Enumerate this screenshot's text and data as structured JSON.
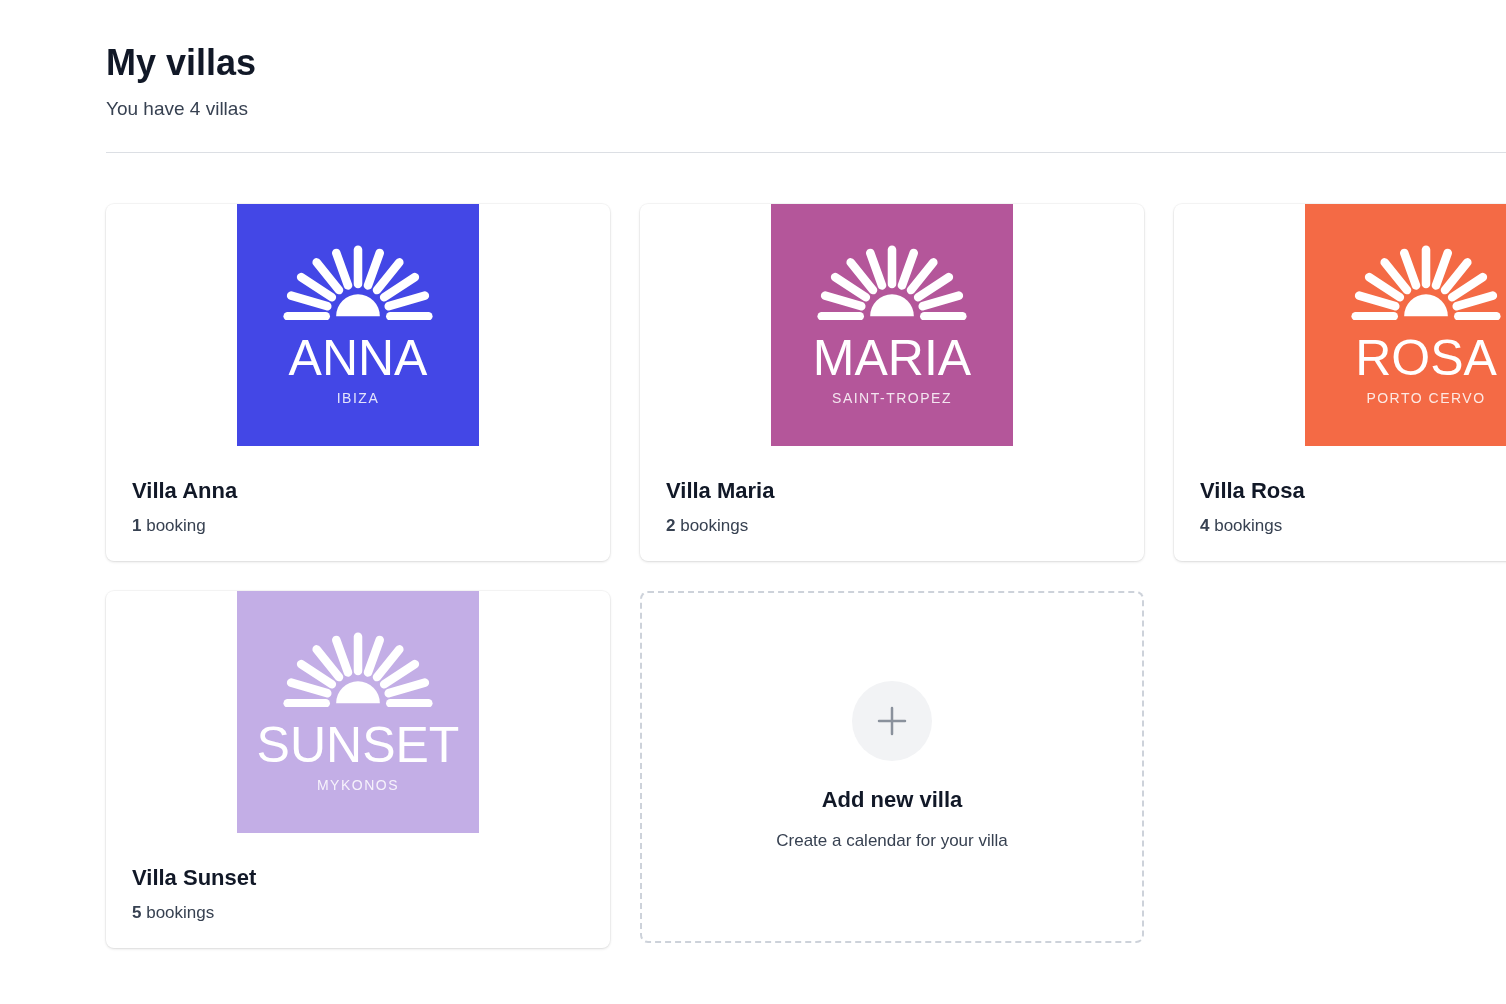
{
  "header": {
    "title": "My villas",
    "subtitle": "You have 4 villas"
  },
  "villas": [
    {
      "logo_name": "ANNA",
      "logo_location": "IBIZA",
      "color": "#4347e6",
      "name": "Villa Anna",
      "bookings": "**1** booking"
    },
    {
      "logo_name": "MARIA",
      "logo_location": "SAINT-TROPEZ",
      "color": "#b4569a",
      "name": "Villa Maria",
      "bookings": "**2** bookings"
    },
    {
      "logo_name": "ROSA",
      "logo_location": "PORTO CERVO",
      "color": "#f46a45",
      "name": "Villa Rosa",
      "bookings": "**4** bookings"
    },
    {
      "logo_name": "SUNSET",
      "logo_location": "MYKONOS",
      "color": "#c3aee6",
      "name": "Villa Sunset",
      "bookings": "**5** bookings"
    }
  ],
  "add_card": {
    "title": "Add new villa",
    "description": "Create a calendar for your villa"
  }
}
